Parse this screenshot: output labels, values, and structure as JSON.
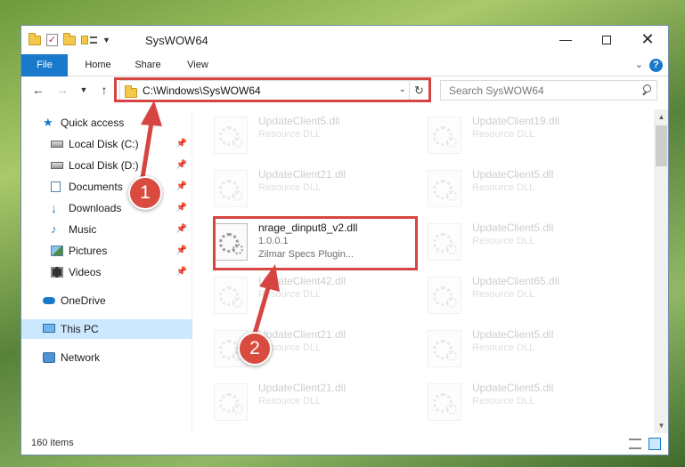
{
  "window": {
    "title": "SysWOW64",
    "minimize_glyph": "—",
    "close_glyph": "✕"
  },
  "ribbon": {
    "tabs": [
      "File",
      "Home",
      "Share",
      "View"
    ]
  },
  "nav": {
    "address": "C:\\Windows\\SysWOW64",
    "search_placeholder": "Search SysWOW64"
  },
  "sidebar": {
    "items": [
      {
        "label": "Quick access",
        "icon": "star-icon"
      },
      {
        "label": "Local Disk (C:)",
        "icon": "drive-icon",
        "pinned": true
      },
      {
        "label": "Local Disk (D:)",
        "icon": "drive-icon",
        "pinned": true
      },
      {
        "label": "Documents",
        "icon": "documents-icon",
        "pinned": true
      },
      {
        "label": "Downloads",
        "icon": "download-icon",
        "pinned": true
      },
      {
        "label": "Music",
        "icon": "music-icon",
        "pinned": true
      },
      {
        "label": "Pictures",
        "icon": "pictures-icon",
        "pinned": true
      },
      {
        "label": "Videos",
        "icon": "videos-icon",
        "pinned": true
      },
      {
        "label": "OneDrive",
        "icon": "cloud-icon"
      },
      {
        "label": "This PC",
        "icon": "computer-icon",
        "selected": true
      },
      {
        "label": "Network",
        "icon": "network-icon"
      }
    ]
  },
  "files": {
    "left": [
      {
        "name": "UpdateClient5.dll",
        "l1": "Resource DLL",
        "l2": ""
      },
      {
        "name": "UpdateClient21.dll",
        "l1": "Resource DLL",
        "l2": ""
      },
      {
        "name": "nrage_dinput8_v2.dll",
        "l1": "1.0.0.1",
        "l2": "Zilmar Specs Plugin..."
      },
      {
        "name": "UpdateClient42.dll",
        "l1": "Resource DLL",
        "l2": ""
      },
      {
        "name": "UpdateClient21.dll",
        "l1": "Resource DLL",
        "l2": ""
      },
      {
        "name": "UpdateClient21.dll",
        "l1": "Resource DLL",
        "l2": ""
      }
    ],
    "right": [
      {
        "name": "UpdateClient19.dll",
        "l1": "Resource DLL",
        "l2": ""
      },
      {
        "name": "UpdateClient5.dll",
        "l1": "Resource DLL",
        "l2": ""
      },
      {
        "name": "UpdateClient5.dll",
        "l1": "Resource DLL",
        "l2": ""
      },
      {
        "name": "UpdateClient65.dll",
        "l1": "Resource DLL",
        "l2": ""
      },
      {
        "name": "UpdateClient5.dll",
        "l1": "Resource DLL",
        "l2": ""
      },
      {
        "name": "UpdateClient5.dll",
        "l1": "Resource DLL",
        "l2": ""
      }
    ]
  },
  "status": {
    "item_count": "160 items"
  },
  "annotations": {
    "badge1": "1",
    "badge2": "2",
    "color": "#d64541"
  }
}
